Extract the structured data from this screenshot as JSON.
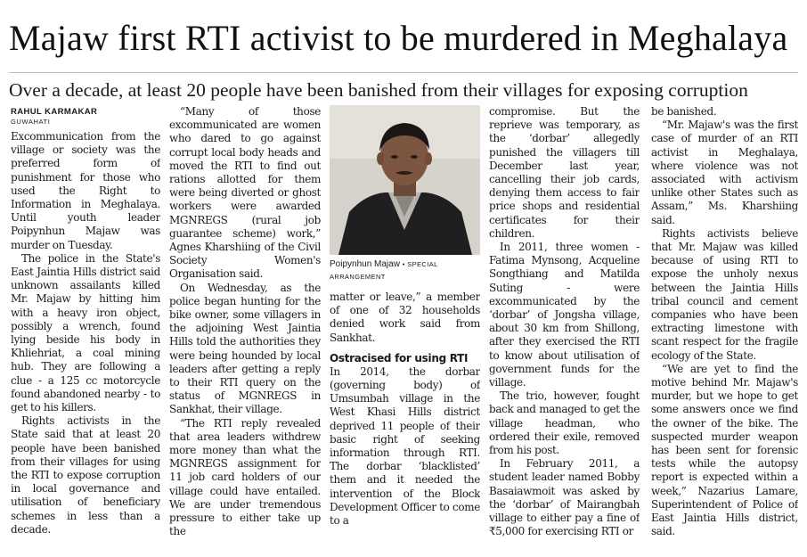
{
  "headline": "Majaw first RTI activist to be murdered in Meghalaya",
  "subheadline": "Over a decade, at least 20 people have been banished from their villages for exposing corruption",
  "byline": "RAHUL KARMAKAR",
  "dateline": "GUWAHATI",
  "photo": {
    "caption_name": "Poipynhun Majaw",
    "caption_credit": "• SPECIAL ARRANGEMENT"
  },
  "subheading": "Ostracised for using RTI",
  "columns": {
    "col1": [
      "Excommunication from the village or society was the preferred form of punishment for those who used the Right to Information in Meghalaya. Until youth leader Poipynhun Majaw was murder on Tuesday.",
      "The police in the State's East Jaintia Hills district said unknown assailants killed Mr. Majaw by hitting him with a heavy iron object, possibly a wrench, found lying beside his body in Khliehriat, a coal mining hub. They are following a clue - a 125 cc motorcycle found abandoned nearby - to get to his killers.",
      "Rights activists in the State said that at least 20 people have been banished from their villages for using the RTI to expose corruption in local governance and utilisation of beneficiary schemes in less than a decade."
    ],
    "col2": [
      "“Many of those excommunicated are women who dared to go against corrupt local body heads and moved the RTI to find out rations allotted for them were being diverted or ghost workers were awarded MGNREGS (rural job guarantee scheme) work,” Agnes Kharshiing of the Civil Society Women's Organisation said.",
      "On Wednesday, as the police began hunting for the bike owner, some villagers in the adjoining West Jaintia Hills told the authorities they were being hounded by local leaders after getting a reply to their RTI query on the status of MGNREGS in Sankhat, their village.",
      "“The RTI reply revealed that area leaders withdrew more money than what the MGNREGS assignment for 11 job card holders of our village could have entailed. We are under tremendous pressure to either take up the"
    ],
    "col3": [
      "matter or leave,” a member of one of 32 households denied work said from Sankhat.",
      "In 2014, the dorbar (governing body) of Umsumbah village in the West Khasi Hills district deprived 11 people of their basic right of seeking information through RTI. The dorbar ‘blacklisted’ them and it needed the intervention of the Block Development Officer to come to a"
    ],
    "col4": [
      "compromise. But the reprieve was temporary, as the ‘dorbar’ allegedly punished the villagers till December last year, cancelling their job cards, denying them access to fair price shops and residential certificates for their children.",
      "In 2011, three women - Fatima Mynsong, Acqueline Songthiang and Matilda Suting - were excommunicated by the ‘dorbar’ of Jongsha village, about 30 km from Shillong, after they exercised the RTI to know about utilisation of government funds for the village.",
      "The trio, however, fought back and managed to get the village headman, who ordered their exile, removed from his post.",
      "In February 2011, a student leader named Bobby Basaiawmoit was asked by the ‘dorbar’ of Mairangbah village to either pay a fine of ₹5,000 for exercising RTI or"
    ],
    "col5": [
      "be banished.",
      "“Mr. Majaw's was the first case of murder of an RTI activist in Meghalaya, where violence was not associated with activism unlike other States such as Assam,” Ms. Kharshiing said.",
      "Rights activists believe that Mr. Majaw was killed because of using RTI to expose the unholy nexus between the Jaintia Hills tribal council and cement companies who have been extracting limestone with scant respect for the fragile ecology of the State.",
      "“We are yet to find the motive behind Mr. Majaw's murder, but we hope to get some answers once we find the owner of the bike. The suspected murder weapon has been sent for forensic tests while the autopsy report is expected within a week,” Nazarius Lamare, Superintendent of Police of East Jaintia Hills district, said."
    ]
  }
}
